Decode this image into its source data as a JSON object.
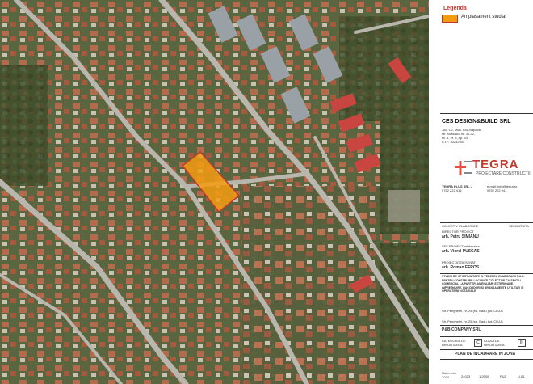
{
  "legend": {
    "title": "Legenda",
    "item_label": "Amplasament studiat",
    "swatch_color": "#f39c12",
    "border_color": "#c0392b"
  },
  "designer": {
    "name": "CES DESIGN&BUILD SRL",
    "address": [
      "Jud. CJ, Mun. Cluj-Napoca,",
      "str. Motoailor nr. 30-32,",
      "sc. 1, et. 8, ap. 53",
      "C.I.F. 40242604"
    ]
  },
  "partner": {
    "logo_text": "TEGRA",
    "logo_subtitle": "PROIECTARE CONSTRUCTII",
    "contact_left": [
      "TEGRA PLUS SRL J",
      "0752 222 416"
    ],
    "contact_right": [
      "e-mail: info@tegra.ro",
      "0752 222 041"
    ]
  },
  "roles": {
    "coll_label": "COLECTIV ELABORARE",
    "sign_label": "SEMNATURA",
    "director_label": "DIRECTOR PROIECT",
    "director_name": "arh. Petru SIMIANU",
    "sef_label": "SEF PROIECT arhitectura",
    "sef_name": "arh. Viorel PUSCAS",
    "proiectat_label": "PROIECTAT/DESENAT",
    "proiectat_name": "arh. Roman EFROS"
  },
  "project": {
    "title": "STUDIU DE OPORTUNITATE IN VEDEREA ELABORARII P.U.Z. PENTRU CONSTRUIRE LOCUINTE COLECTIVE CU SPATIU COMERCIAL LA PARTER, AMENAJARI EXTERIOARE, IMPREJMUIRE, RACORDURI SI BRANSAMENTE UTILITATI SI OPERATIUNI NOTARIALE",
    "address1": "Str. Penghetei, nr. 25 (str. Badu jud. CLUJ)",
    "address2": "Str. Penghetei, nr. 25 (str. Badu jud. CLUJ)"
  },
  "beneficiary": {
    "name": "P&B COMPANY SRL"
  },
  "category": {
    "label1": "CATEGORIA DE IMPORTANTA",
    "value1": "C",
    "label2": "CLASA DE IMPORTANTA",
    "value2": "III"
  },
  "sheet": {
    "title": "PLAN DE INCADRARE IN ZONA",
    "date": "Noiembrie 2024",
    "project_no": "24033",
    "scale": "1:2500",
    "phase": "PUZ",
    "plan_no": "U.01"
  }
}
